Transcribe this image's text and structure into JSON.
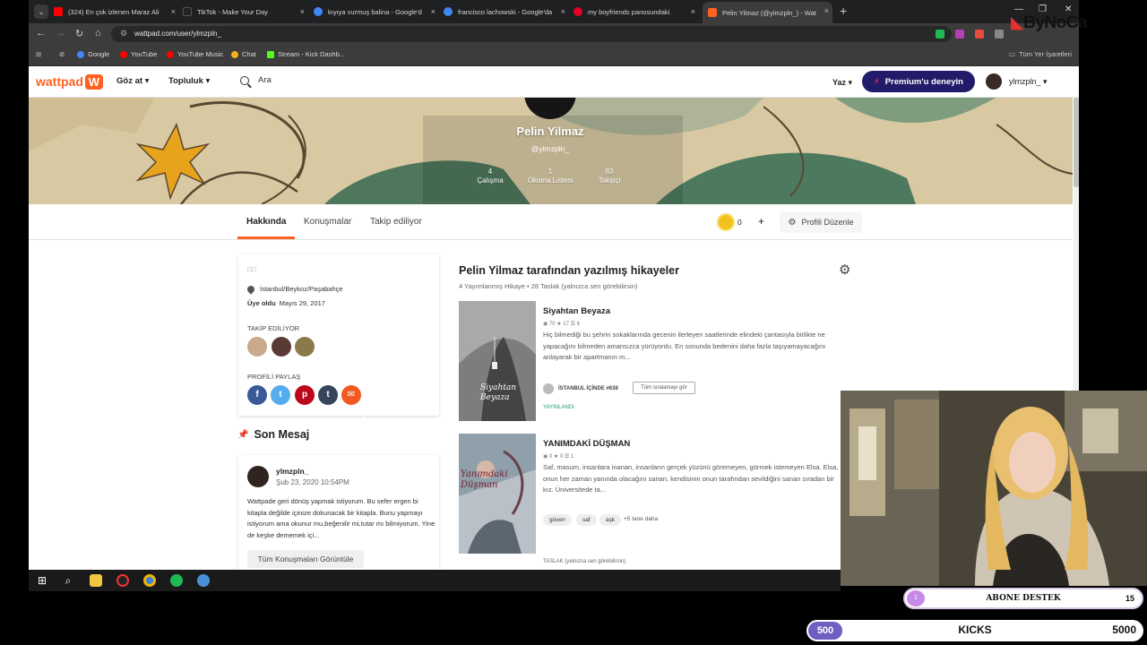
{
  "browser": {
    "tabs": [
      {
        "label": "(324) En çok izlenen Maraz Ali",
        "favicon_color": "#ff0000"
      },
      {
        "label": "TikTok - Make Your Day",
        "favicon_color": "#222222"
      },
      {
        "label": "kıyıya vurmuş balina - Google'd",
        "favicon_color": "#4285f4"
      },
      {
        "label": "francisco lachowski - Google'da",
        "favicon_color": "#4285f4"
      },
      {
        "label": "my boyfriends panosundaki",
        "favicon_color": "#e60023"
      },
      {
        "label": "Pelin Yilmaz (@ylmzpln_) - Wat",
        "favicon_color": "#ff6122"
      }
    ],
    "url": "wattpad.com/user/ylmzpln_",
    "bookmarks": [
      {
        "label": "Google",
        "color": "#4285f4"
      },
      {
        "label": "YouTube",
        "color": "#ff0000"
      },
      {
        "label": "YouTube Music",
        "color": "#ff0000"
      },
      {
        "label": "Chat",
        "color": "#f2b01e"
      },
      {
        "label": "Stream - Kick Dashb...",
        "color": "#53fc18"
      }
    ],
    "all_bookmarks": "Tüm Yer İşaretleri"
  },
  "brand_overlay": "ByNoCa",
  "wattpad": {
    "logo": "wattpad",
    "nav": {
      "browse": "Göz at ▾",
      "community": "Topluluk ▾"
    },
    "search_placeholder": "Ara",
    "write": "Yaz ▾",
    "premium": "Premium'u deneyin",
    "username": "ylmzpln_ ▾"
  },
  "profile": {
    "name": "Pelin Yilmaz",
    "handle": "@ylmzpln_",
    "stats": [
      {
        "value": "4",
        "label": "Çalışma"
      },
      {
        "value": "1",
        "label": "Okuma Listesi"
      },
      {
        "value": "83",
        "label": "Takipçi"
      }
    ],
    "tabs": [
      "Hakkında",
      "Konuşmalar",
      "Takip ediliyor"
    ],
    "coins": "0",
    "edit_label": "Profili Düzenle"
  },
  "about": {
    "description": "□□",
    "location": "İstanbul/Beykoz/Paşabahçe",
    "joined_label": "Üye oldu",
    "joined_date": "Mayıs 29, 2017",
    "following_label": "TAKİP EDİLİYOR",
    "share_label": "PROFİLİ PAYLAŞ"
  },
  "last_message": {
    "section_title": "Son Mesaj",
    "user": "ylmzpln_",
    "date": "Şub 23, 2020 10:54PM",
    "text": "Wattpade geri dönüş yapmak istiyorum. Bu sefer ergen bi kitapla değilde içinize dokunacak bir kitapla. Bunu yapmayı istiyorum ama okunur mu,beğenilir mi,tutar mı bilmiyorum. Yine de keşke dememek içi...",
    "button": "Tüm Konuşmaları Görüntüle"
  },
  "stories": {
    "title": "Pelin Yilmaz tarafından yazılmış hikayeler",
    "subtitle": "4 Yayımlanmış Hikaye • 28 Taslak (yalnızca sen görebilirsin)",
    "items": [
      {
        "title": "Siyahtan Beyaza",
        "meta": "◉ 70   ★ 17   ☰ 6",
        "description": "Hiç bilmediği bu şehrin sokaklarında gecenin ilerleyen saatlerinde elindeki çantasıyla birlikte ne yapacağını bilmeden amansızca yürüyordu. En sonunda bedenini daha fazla taşıyamayacağını anlayarak bir apartmanın m...",
        "rank": "İSTANBUL İÇİNDE #638",
        "rank_button": "Tüm sıralamayı gör",
        "status": "YAYINLANDI",
        "cover_text": "Siyahtan Beyaza"
      },
      {
        "title": "YANIMDAKİ DÜŞMAN",
        "meta": "◉ 0   ★ 0   ☰ 1",
        "description": "Saf, masum, insanlara inanan, insanların gerçek yüzünü göremeyen, görmek istemeyen Elsa. Elsa, onun her zaman yanında olacağını sanan, kendisinin onun tarafından sevildiğini sanan sıradan bir kız. Üniversitede ta...",
        "tags": [
          "güven",
          "saf",
          "aşk"
        ],
        "more_tags": "+5 tane daha",
        "status": "TASLAK (yalnızca sen görebilirsin)",
        "cover_text": "Yanımdaki Düşman"
      }
    ]
  },
  "stream": {
    "abone_label": "ABONE DESTEK",
    "abone_current": "1",
    "abone_goal": "15",
    "kicks_label": "KICKS",
    "kicks_current": "500",
    "kicks_goal": "5000"
  },
  "colors": {
    "wattpad_orange": "#ff6122",
    "premium_bg": "#221b6a",
    "published_green": "#1f9e7a"
  }
}
